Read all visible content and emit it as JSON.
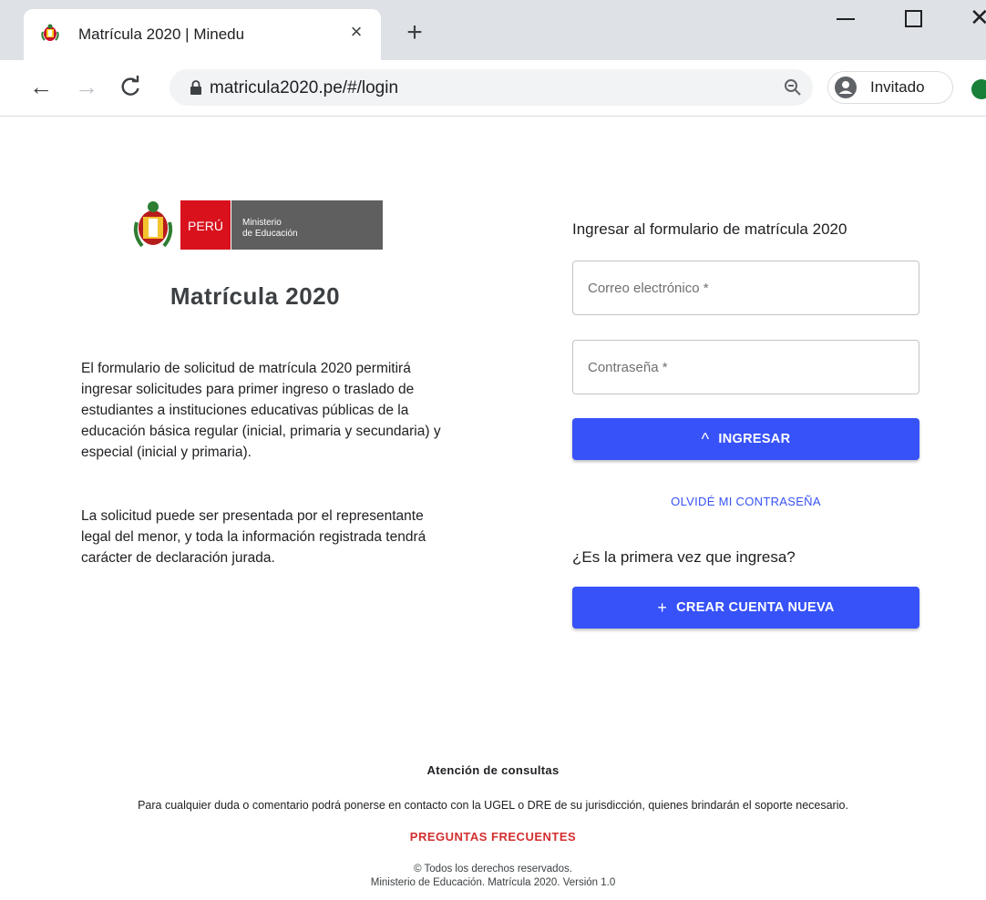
{
  "browser": {
    "tab_title": "Matrícula 2020 | Minedu",
    "tab_close": "×",
    "new_tab": "+",
    "url": "matricula2020.pe/#/login",
    "profile_name": "Invitado"
  },
  "logo": {
    "country": "PERÚ",
    "ministry_line1": "Ministerio",
    "ministry_line2": "de Educación"
  },
  "left": {
    "title": "Matrícula 2020",
    "paragraph1": "El formulario de solicitud de matrícula 2020 permitirá ingresar solicitudes para primer ingreso o traslado de estudiantes a instituciones educativas públicas de la educación básica regular (inicial, primaria y secundaria) y especial (inicial y primaria).",
    "paragraph2": "La solicitud puede ser presentada por el representante legal del menor, y toda la información registrada tendrá carácter de declaración jurada."
  },
  "form": {
    "heading": "Ingresar al formulario de matrícula 2020",
    "email_placeholder": "Correo electrónico *",
    "password_placeholder": "Contraseña *",
    "login_label": "INGRESAR",
    "forgot_label": "OLVIDÉ MI CONTRASEÑA",
    "first_time": "¿Es la primera vez que ingresa?",
    "create_label": "CREAR CUENTA NUEVA",
    "create_icon": "+",
    "login_icon": "^"
  },
  "footer": {
    "title": "Atención de consultas",
    "text": "Para cualquier duda o comentario podrá ponerse en contacto con la UGEL o DRE de su jurisdicción, quienes brindarán el soporte necesario.",
    "faq": "PREGUNTAS FRECUENTES",
    "rights": "© Todos los derechos reservados.",
    "version": "Ministerio de Educación. Matrícula 2020. Versión 1.0"
  },
  "colors": {
    "primary": "#3752f8",
    "faq": "#d32f2f",
    "peru_red": "#d8111c",
    "ministry_gray": "#5f5f5f"
  }
}
